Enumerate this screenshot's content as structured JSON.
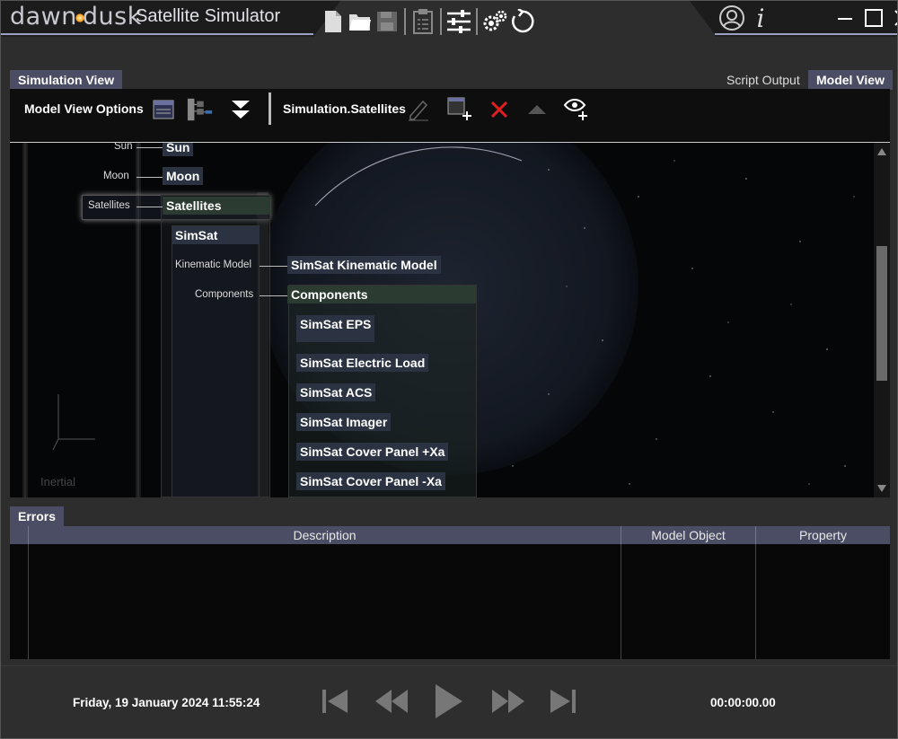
{
  "app": {
    "brand_left": "dawn",
    "brand_right": "dusk",
    "title": "Satellite Simulator"
  },
  "toolbar_icons": [
    "new-file-icon",
    "open-folder-icon",
    "save-icon",
    "clipboard-icon",
    "sliders-icon",
    "gears-icon",
    "reset-icon"
  ],
  "window": {
    "icons": [
      "user-icon",
      "info-icon",
      "minimize-icon",
      "maximize-icon",
      "close-icon"
    ],
    "info_glyph": "i"
  },
  "tabs": {
    "simulation_view": "Simulation View",
    "script_output": "Script Output",
    "model_view": "Model View",
    "errors": "Errors"
  },
  "model_toolbar": {
    "options_label": "Model View Options",
    "path_label": "Simulation.Satellites"
  },
  "canvas": {
    "frame_label": "Inertial"
  },
  "tree": {
    "sun_label": "Sun",
    "sun_node": "Sun",
    "moon_label": "Moon",
    "moon_node": "Moon",
    "satellites_label": "Satellites",
    "satellites_node": "Satellites",
    "simsat_node": "SimSat",
    "kinematic_label": "Kinematic Model",
    "kinematic_node": "SimSat Kinematic Model",
    "components_label": "Components",
    "components_node": "Components",
    "components": [
      "SimSat EPS",
      "SimSat Electric Load",
      "SimSat ACS",
      "SimSat Imager",
      "SimSat Cover Panel +Xa",
      "SimSat Cover Panel -Xa"
    ]
  },
  "errors_table": {
    "columns": [
      "Description",
      "Model Object",
      "Property"
    ],
    "rows": []
  },
  "playback": {
    "datetime": "Friday, 19 January 2024 11:55:24",
    "elapsed": "00:00:00.00"
  }
}
